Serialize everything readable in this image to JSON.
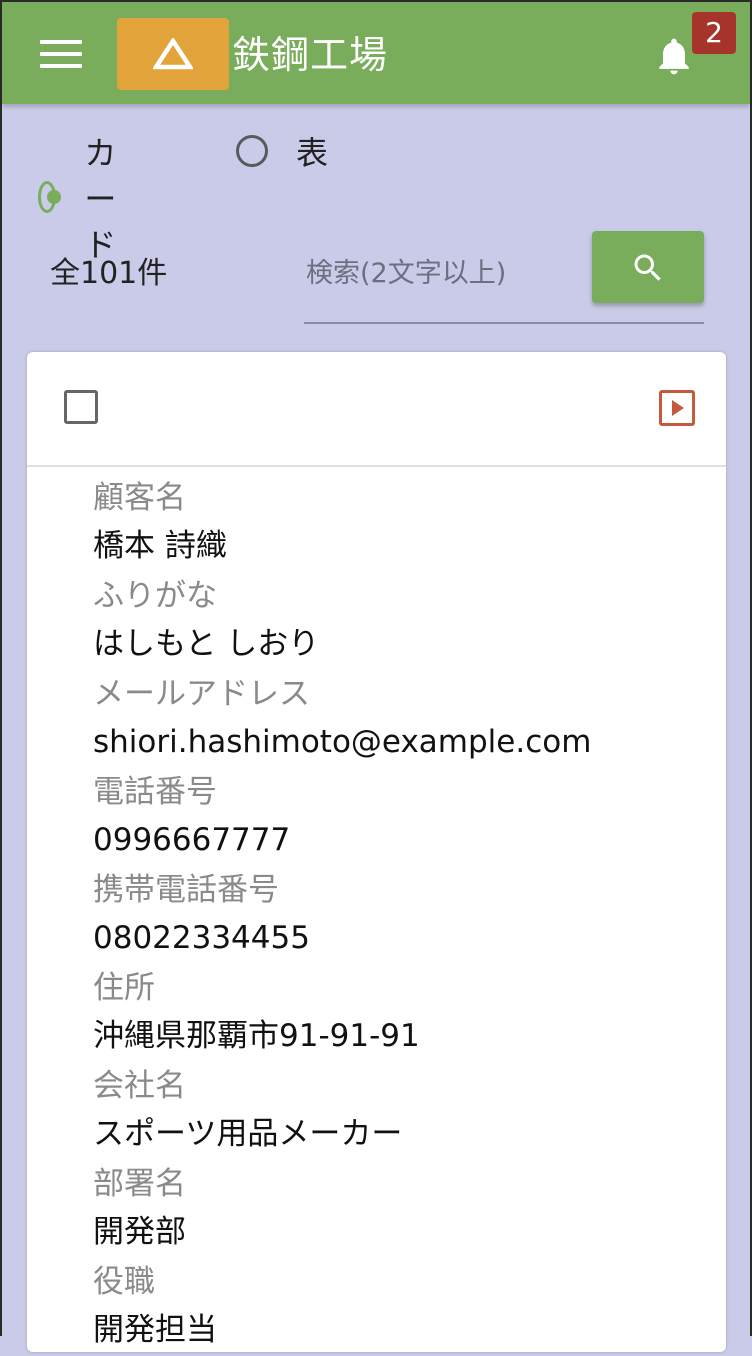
{
  "header": {
    "title": "鉄鋼工場",
    "notification_count": "2",
    "accent": "#79ad5b",
    "logo_color": "#e3a33b",
    "badge_color": "#a7342a"
  },
  "view_toggle": {
    "options": [
      {
        "label": "カード",
        "selected": true
      },
      {
        "label": "表",
        "selected": false
      }
    ]
  },
  "list": {
    "total": "全101件",
    "search_placeholder": "検索(2文字以上)"
  },
  "card": {
    "fields": [
      {
        "label": "顧客名",
        "value": "橋本 詩織"
      },
      {
        "label": "ふりがな",
        "value": "はしもと しおり"
      },
      {
        "label": "メールアドレス",
        "value": "shiori.hashimoto@example.com"
      },
      {
        "label": "電話番号",
        "value": "0996667777"
      },
      {
        "label": "携帯電話番号",
        "value": "08022334455"
      },
      {
        "label": "住所",
        "value": "沖縄県那覇市91-91-91"
      },
      {
        "label": "会社名",
        "value": "スポーツ用品メーカー"
      },
      {
        "label": "部署名",
        "value": "開発部"
      },
      {
        "label": "役職",
        "value": "開発担当"
      }
    ]
  }
}
